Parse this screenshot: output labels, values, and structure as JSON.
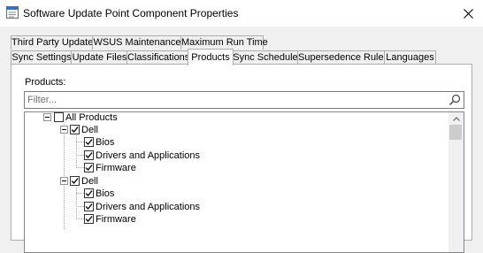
{
  "window": {
    "title": "Software Update Point Component Properties",
    "icon": "properties-dialog-icon",
    "close_icon": "close-icon"
  },
  "tabs": {
    "row_top": [
      {
        "label": "Third Party Updates"
      },
      {
        "label": "WSUS Maintenance"
      },
      {
        "label": "Maximum Run Time"
      }
    ],
    "row_bottom": [
      {
        "label": "Sync Settings"
      },
      {
        "label": "Update Files"
      },
      {
        "label": "Classifications"
      },
      {
        "label": "Products",
        "active": true
      },
      {
        "label": "Sync Schedule"
      },
      {
        "label": "Supersedence Rules"
      },
      {
        "label": "Languages"
      }
    ]
  },
  "products": {
    "label": "Products:",
    "filter_placeholder": "Filter...",
    "tree": [
      {
        "label": "All Products",
        "checked": false,
        "expanded": true,
        "level": 0
      },
      {
        "label": "Dell",
        "checked": true,
        "expanded": true,
        "level": 1
      },
      {
        "label": "Bios",
        "checked": true,
        "level": 2
      },
      {
        "label": "Drivers and Applications",
        "checked": true,
        "level": 2
      },
      {
        "label": "Firmware",
        "checked": true,
        "level": 2
      },
      {
        "label": "Dell",
        "checked": true,
        "expanded": true,
        "level": 1
      },
      {
        "label": "Bios",
        "checked": true,
        "level": 2
      },
      {
        "label": "Drivers and Applications",
        "checked": true,
        "level": 2
      },
      {
        "label": "Firmware",
        "checked": true,
        "level": 2
      }
    ]
  }
}
